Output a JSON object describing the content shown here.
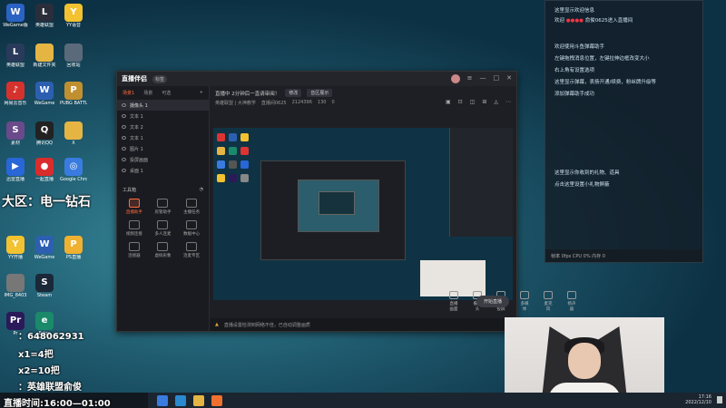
{
  "desktop": {
    "icons": [
      {
        "label": "WeGame版",
        "color": "#2b63c5",
        "glyph": "W"
      },
      {
        "label": "英雄联盟",
        "color": "#2a2e3a",
        "glyph": "L"
      },
      {
        "label": "YY语音",
        "color": "#f2c230",
        "glyph": "Y"
      },
      {
        "label": "英雄联盟",
        "color": "#2a3a5a",
        "glyph": "L"
      },
      {
        "label": "新建文件夹",
        "color": "#e5b544",
        "glyph": ""
      },
      {
        "label": "回收站",
        "color": "#5a6a7a",
        "glyph": ""
      },
      {
        "label": "网易云音乐",
        "color": "#d6322d",
        "glyph": "♪"
      },
      {
        "label": "WeGame",
        "color": "#2d5fb0",
        "glyph": "W"
      },
      {
        "label": "PUBG BATTLEG..",
        "color": "#c09030",
        "glyph": "P"
      },
      {
        "label": "素材",
        "color": "#6a4a8a",
        "glyph": "S"
      },
      {
        "label": "腾讯QQ",
        "color": "#222",
        "glyph": "Q"
      },
      {
        "label": "X",
        "color": "#e5b544",
        "glyph": ""
      },
      {
        "label": "迅雷直播",
        "color": "#2966d8",
        "glyph": "▶"
      },
      {
        "label": "一起直播",
        "color": "#d92c2c",
        "glyph": "●"
      },
      {
        "label": "Google Chrome",
        "color": "#3a7be0",
        "glyph": "◎"
      },
      {
        "label": "YY开播",
        "color": "#f2c230",
        "glyph": "Y"
      },
      {
        "label": "WeGame",
        "color": "#2d5fb0",
        "glyph": "W"
      },
      {
        "label": "PS直播",
        "color": "#f0b030",
        "glyph": "P"
      },
      {
        "label": "IMG_8403",
        "color": "#777",
        "glyph": ""
      },
      {
        "label": "Steam",
        "color": "#1b2838",
        "glyph": "S"
      },
      {
        "label": "Pr",
        "color": "#2a1a5a",
        "glyph": "Pr"
      },
      {
        "label": "Edge",
        "color": "#1a8a6a",
        "glyph": "e"
      }
    ],
    "overlay": {
      "region": "大区：电一钻石",
      "wechat": "：648062931",
      "x1": "x1=4把",
      "x2": "x2=10把",
      "douyin": "：英雄联盟俞俊",
      "live_time": "直播时间:16:00—01:00"
    }
  },
  "app": {
    "logo": "直播伴侣",
    "badge": "标签",
    "left_tabs": [
      "场景1",
      "场景",
      "可选"
    ],
    "sources": [
      {
        "name": "摄像头 1",
        "selected": true
      },
      {
        "name": "文本 1",
        "selected": false
      },
      {
        "name": "文本 2",
        "selected": false
      },
      {
        "name": "文本 1",
        "selected": false
      },
      {
        "name": "图片 1",
        "selected": false
      },
      {
        "name": "投屏画面",
        "selected": false
      },
      {
        "name": "桌面 1",
        "selected": false
      }
    ],
    "tools_header": "工具箱",
    "tools": [
      {
        "label": "直播助手",
        "hot": true
      },
      {
        "label": "房管助手",
        "hot": false
      },
      {
        "label": "主播任务",
        "hot": false
      },
      {
        "label": "视频连接",
        "hot": false
      },
      {
        "label": "多人连麦",
        "hot": false
      },
      {
        "label": "数据中心",
        "hot": false
      },
      {
        "label": "连接器",
        "hot": false
      },
      {
        "label": "虚拟形象",
        "hot": false
      },
      {
        "label": "连麦专区",
        "hot": false
      }
    ],
    "top_line": "直播中 2分钟后一直请审阅！",
    "top_pill1": "修改",
    "top_pill2": "音区展示",
    "stats": [
      "英雄联盟 | 大神教学",
      "直播间0625",
      "2124396",
      "130",
      "0"
    ],
    "bottom_tools": [
      "直播画面",
      "摄像头",
      "手机投屏",
      "多媒体",
      "麦克风",
      "扬声器"
    ],
    "start_button": "开始直播",
    "status_text": "直播设置检测到网络不佳，已自动调整画质"
  },
  "chat": {
    "lines": [
      {
        "text": "这里显示欢迎信息",
        "hl": false
      },
      {
        "text": "欢迎 ●●●● 俞俊0625进入直播间",
        "hl": true
      },
      {
        "text": "欢迎使用斗鱼弹幕助手",
        "hl": false
      },
      {
        "text": "左键拖拽消息位置，左键拉伸边框改变大小",
        "hl": false
      },
      {
        "text": "右上角有设置选项",
        "hl": false
      },
      {
        "text": "这里显示弹幕，表扬开通/续费，粉丝牌升级等",
        "hl": false
      },
      {
        "text": "添加弹幕助手成功",
        "hl": false
      },
      {
        "text": "这里显示你收到的礼物、道具",
        "hl": false
      },
      {
        "text": "点击这里设置小礼物屏蔽",
        "hl": false
      }
    ],
    "footer": "帧率 0fps  CPU 0%  内存 0"
  },
  "taskbar": {
    "time": "17:16",
    "date": "2022/12/10"
  }
}
